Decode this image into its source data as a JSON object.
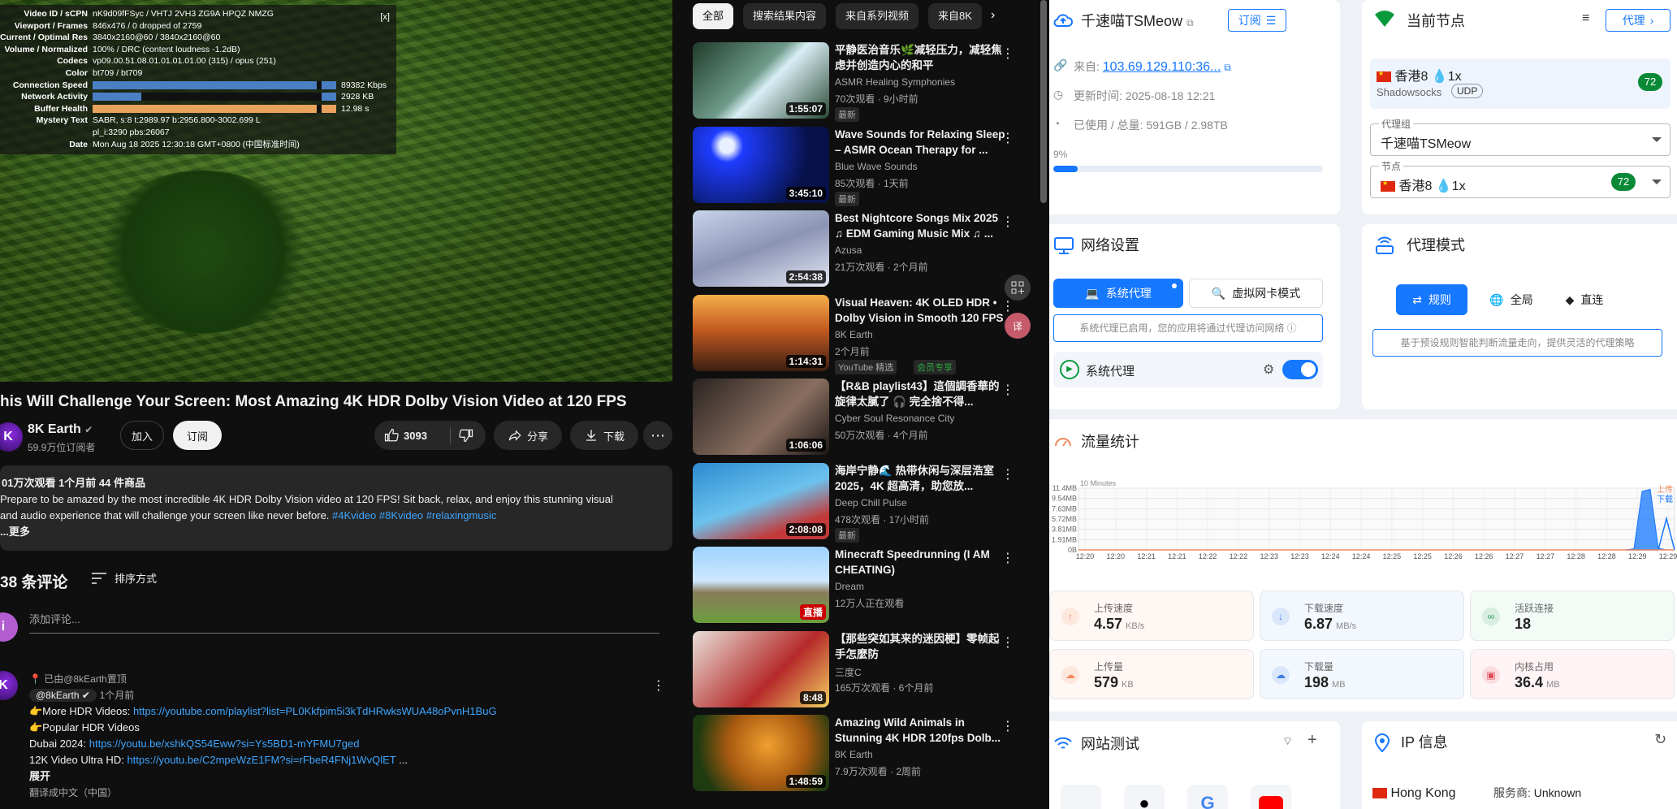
{
  "youtube": {
    "stats": {
      "rows": [
        {
          "k": "Video ID / sCPN",
          "v": "nK9d09fFSyc  /  VHTJ 2VH3 ZG9A HPQZ NMZG"
        },
        {
          "k": "Viewport / Frames",
          "v": "846x476 / 0 dropped of 2759"
        },
        {
          "k": "Current / Optimal Res",
          "v": "3840x2160@60 / 3840x2160@60"
        },
        {
          "k": "Volume / Normalized",
          "v": "100% / DRC (content loudness -1.2dB)"
        },
        {
          "k": "Codecs",
          "v": "vp09.00.51.08.01.01.01.01.00 (315) / opus (251)"
        },
        {
          "k": "Color",
          "v": "bt709 / bt709"
        },
        {
          "k": "Connection Speed",
          "v": "89382 Kbps"
        },
        {
          "k": "Network Activity",
          "v": "2928 KB"
        },
        {
          "k": "Buffer Health",
          "v": "12.98 s"
        },
        {
          "k": "Mystery Text",
          "v": "SABR, s:8 t:2989.97 b:2956.800-3002.699 L"
        },
        {
          "k": "",
          "v": "pl_i:3290 pbs:26067"
        },
        {
          "k": "Date",
          "v": "Mon Aug 18 2025 12:30:18 GMT+0800 (中国标准时间)"
        }
      ],
      "close": "[x]"
    },
    "title": "his Will Challenge Your Screen: Most Amazing 4K HDR Dolby Vision Video at 120 FPS",
    "channel": {
      "avatar": "K",
      "name": "8K Earth",
      "subs": "59.9万位订阅者",
      "join": "加入",
      "subscribe": "订阅"
    },
    "actions": {
      "likes": "3093",
      "share": "分享",
      "download": "下载",
      "more": "⋯"
    },
    "description": {
      "meta": "01万次观看  1个月前  44 件商品",
      "line1": "Prepare to be amazed by the most incredible 4K HDR Dolby Vision video at 120 FPS! Sit back, relax, and enjoy this stunning visual",
      "line2": "and audio experience that will challenge your screen like never before.",
      "tags": "#4Kvideo #8Kvideo #relaxingmusic",
      "more": "...更多"
    },
    "comments": {
      "count": "38 条评论",
      "sort": "排序方式",
      "add_placeholder": "添加评论...",
      "user_avatar": "i",
      "pinned": "已由@8kEarth置顶",
      "author": "@8kEarth",
      "time": "1个月前",
      "l1": "👉More HDR Videos:",
      "l1_link": "https://youtube.com/playlist?list=PL0Kkfpim5i3kTdHRwksWUA48oPvnH1BuG",
      "l2": "👉Popular HDR Videos",
      "l3": "Dubai 2024:",
      "l3_link": "https://youtu.be/xshkQS54Eww?si=Ys5BD1-mYFMU7ged",
      "l4": "12K Video Ultra HD:",
      "l4_link": "https://youtu.be/C2mpeWzE1FM?si=rFbeR4FNj1WvQlET",
      "l4_tail": "...",
      "expand": "展开",
      "translate": "翻译成中文（中国）"
    },
    "chips": [
      "全部",
      "搜索结果内容",
      "来自系列视频",
      "来自8K"
    ],
    "recs": [
      {
        "title": "平静医治音乐🌿减轻压力，减轻焦虑并创造内心的和平",
        "channel": "ASMR Healing Symphonies",
        "meta": "70次观看 · 9小时前",
        "badge": "最新",
        "dur": "1:55:07",
        "bg": "linear-gradient(135deg,#1f3b2a,#6f9a8a 45%,#d9eef5 55%,#2b4a36)"
      },
      {
        "title": "Wave Sounds for Relaxing Sleep – ASMR Ocean Therapy for ...",
        "channel": "Blue Wave Sounds",
        "meta": "85次观看 · 1天前",
        "badge": "最新",
        "dur": "3:45:10",
        "bg": "radial-gradient(circle at 25% 25%,#e8f0ff 0 6%,#1e3cff 14%,#07124a 70%)"
      },
      {
        "title": "Best Nightcore Songs Mix 2025 ♫ EDM Gaming Music Mix ♫ ...",
        "channel": "Azusa",
        "meta": "21万次观看 · 2个月前",
        "badge": "",
        "dur": "2:54:38",
        "bg": "linear-gradient(160deg,#c9d3ea,#8c94b5 50%,#e5e9f5)"
      },
      {
        "title": "Visual Heaven: 4K OLED HDR • Dolby Vision in Smooth 120 FPS",
        "channel": "8K Earth",
        "meta": "2个月前",
        "badge": "YouTube 精选",
        "badge2": "会员专享",
        "dur": "1:14:31",
        "bg": "linear-gradient(180deg,#f4b04a,#c45a20 45%,#3a1e12)"
      },
      {
        "title": "【R&B playlist43】這個調香華的旋律太膩了 🎧 完全捨不得...",
        "channel": "Cyber Soul Resonance City",
        "meta": "50万次观看 · 4个月前",
        "badge": "",
        "dur": "1:06:06",
        "bg": "linear-gradient(135deg,#2a2320,#8a6f60 60%,#1b1614)"
      },
      {
        "title": "海岸宁静🌊 热带休闲与深层浩室 2025，4K 超高清，助您放...",
        "channel": "Deep Chill Pulse",
        "meta": "478次观看 · 17小时前",
        "badge": "最新",
        "dur": "2:08:08",
        "bg": "linear-gradient(160deg,#2d8ad0,#6cc2ee 50%,#c23a3a 80%)"
      },
      {
        "title": "Minecraft Speedrunning (I AM CHEATING)",
        "channel": "Dream",
        "meta": "12万人正在观看",
        "badge": "",
        "dur": "直播",
        "bg": "linear-gradient(180deg,#9fd2ff,#cfe8ff 45%,#8a7c5a 60%,#6b9e3d)"
      },
      {
        "title": "【那些突如其来的迷因梗】零帧起手怎麼防",
        "channel": "三度C",
        "meta": "165万次观看 · 6个月前",
        "badge": "",
        "dur": "8:48",
        "bg": "linear-gradient(135deg,#e8e0d8,#b52a2a 60%,#f3d060)"
      },
      {
        "title": "Amazing Wild Animals in Stunning 4K HDR 120fps Dolb...",
        "channel": "8K Earth",
        "meta": "7.9万次观看 · 2周前",
        "badge": "",
        "dur": "1:48:59",
        "bg": "radial-gradient(circle at 55% 40%,#f0a030,#a85a10 45%,#1e3a10 80%)"
      }
    ]
  },
  "clash": {
    "profile": {
      "title": "千速喵TSMeow",
      "subscribe": "订阅",
      "from_label": "来自:",
      "from": "103.69.129.110:36...",
      "updated": "更新时间: 2025-08-18 12:21",
      "usage": "已使用 / 总量: 591GB / 2.98TB",
      "percent_text": "9%",
      "percent": 9
    },
    "current_node": {
      "title": "当前节点",
      "proxy_btn": "代理",
      "node": "香港8 💧1x",
      "protocol": "Shadowsocks",
      "udp": "UDP",
      "delay": "72",
      "group_label": "代理组",
      "group": "千速喵TSMeow",
      "node_label": "节点",
      "node_sel": "香港8 💧1x",
      "node_delay": "72"
    },
    "network": {
      "title": "网络设置",
      "sys_proxy": "系统代理",
      "tun": "虚拟网卡模式",
      "hint": "系统代理已启用，您的应用将通过代理访问网络",
      "toggle_label": "系统代理"
    },
    "mode": {
      "title": "代理模式",
      "rule": "规则",
      "global": "全局",
      "direct": "直连",
      "hint": "基于预设规则智能判断流量走向，提供灵活的代理策略"
    },
    "traffic": {
      "title": "流量统计",
      "window": "10 Minutes",
      "legend_up": "上传",
      "legend_down": "下载",
      "y_labels": [
        "11.4MB",
        "9.54MB",
        "7.63MB",
        "5.72MB",
        "3.81MB",
        "1.91MB",
        "0B"
      ],
      "x_labels": [
        "12:20",
        "12:20",
        "12:21",
        "12:21",
        "12:22",
        "12:22",
        "12:23",
        "12:23",
        "12:24",
        "12:24",
        "12:25",
        "12:25",
        "12:26",
        "12:26",
        "12:27",
        "12:27",
        "12:28",
        "12:28",
        "12:29",
        "12:29"
      ],
      "download_tail": [
        0,
        0.2,
        10.8,
        11.2,
        0.3,
        0,
        0
      ],
      "upload_tail": [
        0,
        0,
        0,
        0,
        0,
        5.8,
        0
      ]
    },
    "stats": [
      {
        "label": "上传速度",
        "value": "4.57",
        "unit": "KB/s",
        "color": "#f08a5d",
        "bg": "#fff7f3",
        "icon": "↑"
      },
      {
        "label": "下载速度",
        "value": "6.87",
        "unit": "MB/s",
        "color": "#3d7be0",
        "bg": "#f3f8ff",
        "icon": "↓"
      },
      {
        "label": "活跃连接",
        "value": "18",
        "unit": "",
        "color": "#2e9e5a",
        "bg": "#f3fbf6",
        "icon": "∞"
      },
      {
        "label": "上传量",
        "value": "579",
        "unit": "KB",
        "color": "#f08a5d",
        "bg": "#fff7f3",
        "icon": "☁"
      },
      {
        "label": "下载量",
        "value": "198",
        "unit": "MB",
        "color": "#3d7be0",
        "bg": "#f3f8ff",
        "icon": "☁"
      },
      {
        "label": "内核占用",
        "value": "36.4",
        "unit": "MB",
        "color": "#e04a5a",
        "bg": "#fff4f5",
        "icon": "▣"
      }
    ],
    "site_test": {
      "title": "网站测试"
    },
    "ip_info": {
      "title": "IP 信息",
      "region": "Hong Kong",
      "isp_label": "服务商:",
      "isp": "Unknown"
    }
  }
}
